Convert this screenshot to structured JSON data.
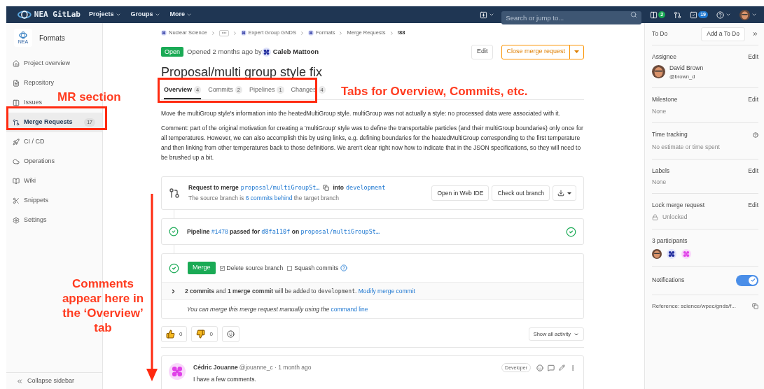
{
  "navbar": {
    "logo": "NEA GitLab",
    "menus": [
      {
        "label": "Projects"
      },
      {
        "label": "Groups"
      },
      {
        "label": "More"
      }
    ],
    "search": {
      "placeholder": "Search or jump to..."
    },
    "counters": [
      {
        "kind": "issues",
        "count": "2"
      },
      {
        "kind": "merge"
      },
      {
        "kind": "todo",
        "count": "19"
      }
    ]
  },
  "sidebar": {
    "project": "Formats",
    "logo_text": "NEA",
    "items": [
      {
        "label": "Project overview",
        "kind": "home",
        "selected": false
      },
      {
        "label": "Repository",
        "kind": "file",
        "selected": false
      },
      {
        "label": "Issues",
        "kind": "issues",
        "selected": false
      },
      {
        "label": "Merge Requests",
        "kind": "merge",
        "count": "17",
        "selected": true
      },
      {
        "label": "CI / CD",
        "kind": "rocket",
        "selected": false
      },
      {
        "label": "Operations",
        "kind": "cloud",
        "selected": false
      },
      {
        "label": "Wiki",
        "kind": "book",
        "selected": false
      },
      {
        "label": "Snippets",
        "kind": "scissors",
        "selected": false
      },
      {
        "label": "Settings",
        "kind": "gear",
        "selected": false
      }
    ],
    "collapse": "Collapse sidebar"
  },
  "breadcrumb": [
    {
      "label": "Nuclear Science",
      "kind": "group"
    },
    {
      "kind": "ellipsis"
    },
    {
      "label": "Expert Group GNDS",
      "kind": "group"
    },
    {
      "label": "Formats",
      "kind": "group"
    },
    {
      "label": "Merge Requests",
      "kind": "plain"
    },
    {
      "label": "!88",
      "kind": "current"
    }
  ],
  "header": {
    "status": "Open",
    "opened": "Opened 2 months ago by",
    "author": "Caleb Mattoon",
    "edit": "Edit",
    "close": "Close merge request"
  },
  "title": "Proposal/multi group style fix",
  "tabs": [
    {
      "label": "Overview",
      "count": "4",
      "selected": true
    },
    {
      "label": "Commits",
      "count": "2",
      "selected": false
    },
    {
      "label": "Pipelines",
      "count": "1",
      "selected": false
    },
    {
      "label": "Changes",
      "count": "4",
      "selected": false
    }
  ],
  "description": [
    "Move the multiGroup style's information into the heatedMultiGroup style. multiGroup was not actually a style: no processed data were associated with it.",
    "Comment: part of the original motivation for creating a 'multiGroup' style was to define the transportable particles (and their multiGroup boundaries) only once for all temperatures. However, we can also accomplish this by using links, e.g. defining boundaries for the heatedMultiGroup corresponding to the first temperature and then linking from other temperatures back to those definitions. We aren't clear right now how to indicate that in the JSON specifications, so they will need to be brushed up a bit."
  ],
  "mr_widget": {
    "prefix": "Request to merge",
    "source": "proposal/multiGroupSt…",
    "joiner": "into",
    "target": "development",
    "behind_before": "The source branch is",
    "behind_link": "6 commits behind",
    "behind_after": "the target branch",
    "web_ide": "Open in Web IDE",
    "checkout": "Check out branch"
  },
  "pipeline": {
    "label": "Pipeline",
    "id": "#1478",
    "passed": "passed for",
    "sha": "d8fa110f",
    "on": "on",
    "branch": "proposal/multiGroupSt…"
  },
  "merge": {
    "button": "Merge",
    "options": [
      {
        "label": "Delete source branch",
        "checked": true
      },
      {
        "label": "Squash commits",
        "checked": false
      }
    ],
    "commits_text": "**2 commits** and **1 merge commit** will be added to",
    "commits_branch": "development",
    "commits_end": ".",
    "modify_link": "Modify merge commit",
    "manual_text": "You can merge this merge request manually using the",
    "manual_link": "command line"
  },
  "awards": [
    {
      "kind": "thumbsup",
      "count": "0"
    },
    {
      "kind": "thumbsdown",
      "count": "0"
    }
  ],
  "show_activity": "Show all activity",
  "comment": {
    "author": "Cédric Jouanne",
    "meta": "@jouanne_c · 1 month ago",
    "role": "Developer",
    "body": "I have a few comments."
  },
  "right": {
    "todo_label": "To Do",
    "todo_button": "Add a To Do",
    "assignee": {
      "label": "Assignee",
      "edit": "Edit",
      "name": "David Brown",
      "handle": "@brown_d"
    },
    "milestone": {
      "label": "Milestone",
      "edit": "Edit",
      "value": "None"
    },
    "time_tracking": {
      "label": "Time tracking",
      "value": "No estimate or time spent"
    },
    "labels": {
      "label": "Labels",
      "edit": "Edit",
      "value": "None"
    },
    "lock": {
      "label": "Lock merge request",
      "edit": "Edit",
      "value": "Unlocked"
    },
    "participants": {
      "label": "3 participants",
      "avatars": [
        {
          "kind": "photo"
        },
        {
          "kind": "blue"
        },
        {
          "kind": "pink"
        }
      ]
    },
    "notifications": {
      "label": "Notifications",
      "on": true
    },
    "reference": "Reference: science/wpec/gnds/f..."
  },
  "annotations": {
    "mr_label": "MR section",
    "tabs_label": "Tabs for Overview, Commits, etc.",
    "comments_label": "Comments appear here in the ‘Overview’ tab"
  }
}
